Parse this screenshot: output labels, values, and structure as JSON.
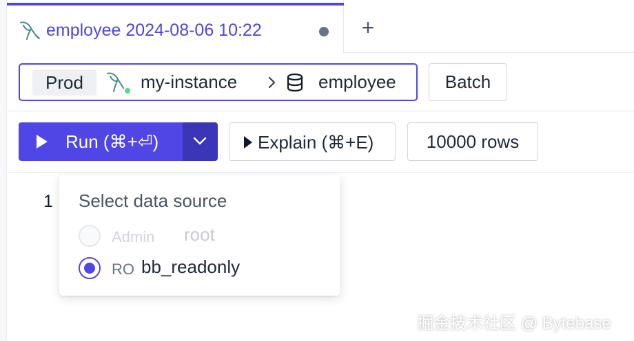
{
  "tab": {
    "title": "employee 2024-08-06 10:22",
    "icon": "mysql-dolphin-icon",
    "unsaved_indicator": "dot",
    "add_label": "+"
  },
  "context": {
    "environment": "Prod",
    "instance": "my-instance",
    "instance_icon": "mysql-dolphin-icon",
    "instance_status_color": "#4ade80",
    "database": "employee",
    "database_icon": "database-icon",
    "batch_label": "Batch"
  },
  "toolbar": {
    "run_label": "Run (⌘+⏎)",
    "explain_label": "Explain (⌘+E)",
    "rows_label": "10000 rows"
  },
  "editor": {
    "line_numbers": [
      "1"
    ]
  },
  "data_source_menu": {
    "title": "Select data source",
    "options": [
      {
        "type": "Admin",
        "name": "root",
        "selected": false,
        "disabled": true
      },
      {
        "type": "RO",
        "name": "bb_readonly",
        "selected": true,
        "disabled": false
      }
    ]
  },
  "watermark": "掘金技术社区 @ Bytebase",
  "colors": {
    "accent": "#4f46e5",
    "accent_dark": "#3b35b8",
    "border": "#d1d5db"
  }
}
